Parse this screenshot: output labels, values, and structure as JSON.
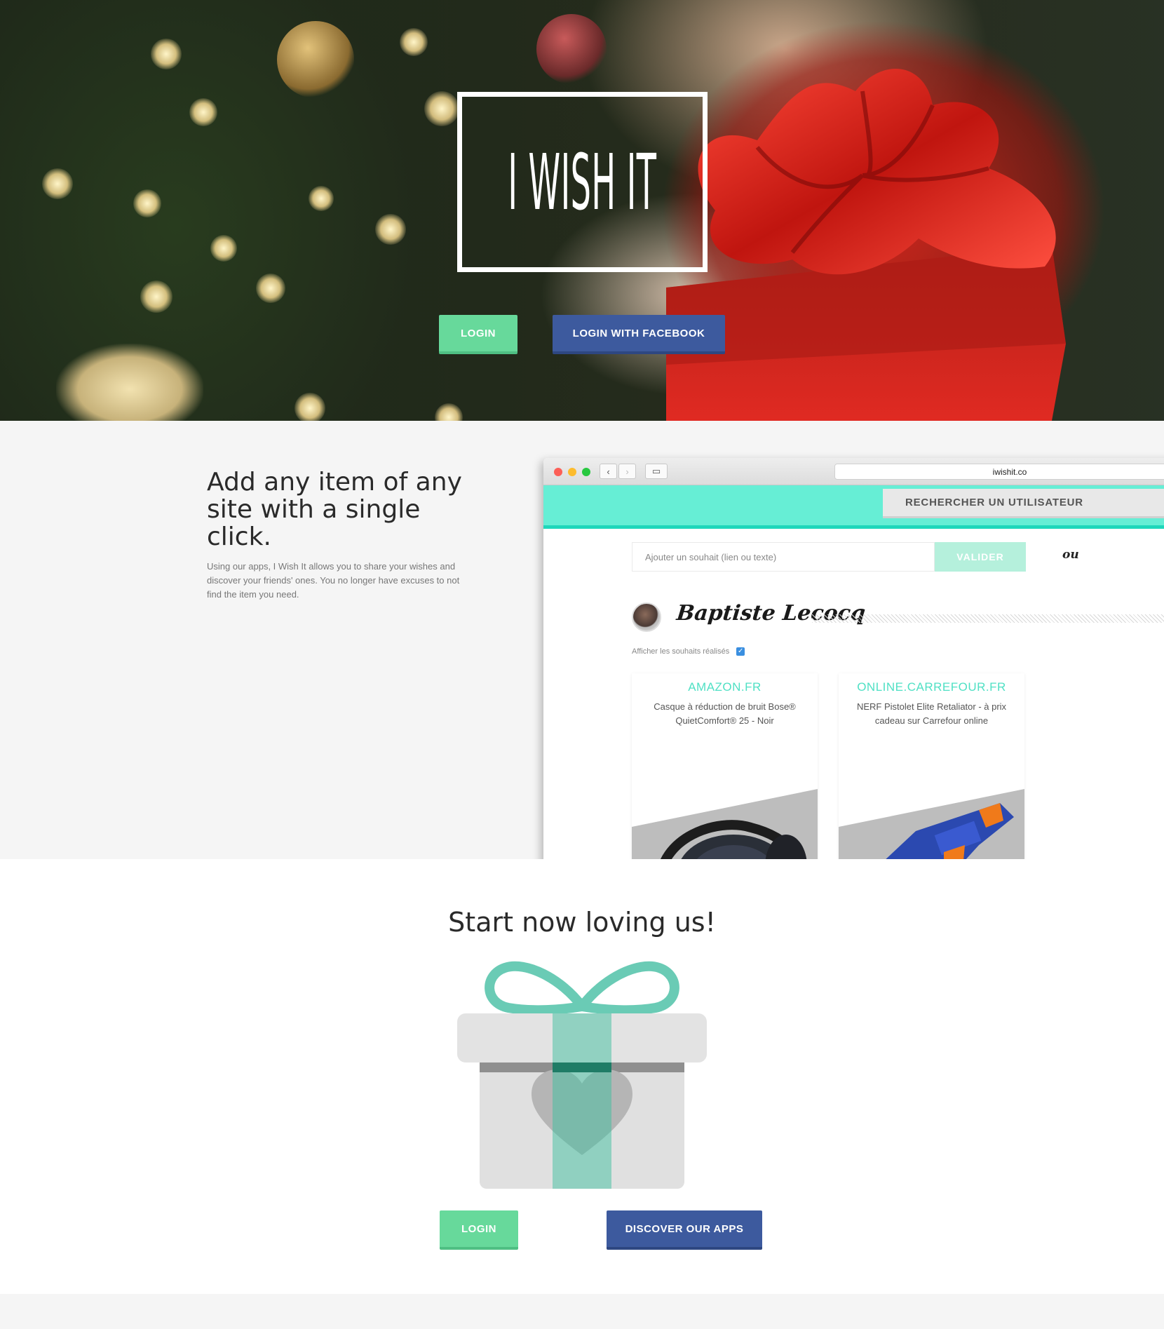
{
  "hero": {
    "logo_text": "I WISH IT",
    "login_label": "LOGIN",
    "facebook_label": "LOGIN WITH FACEBOOK"
  },
  "feature": {
    "title": "Add any item of any site with a single click.",
    "description": "Using our apps, I Wish It allows you to share your wishes and discover your friends' ones. You no longer have excuses to not find the item you need.",
    "browser": {
      "url": "iwishit.co",
      "search_user_label": "RECHERCHER UN UTILISATEUR",
      "wish_placeholder": "Ajouter un souhait (lien ou texte)",
      "valider_label": "VALIDER",
      "or_label": "ou",
      "profile_name": "Baptiste Lecocq",
      "show_done_label": "Afficher les souhaits réalisés",
      "cards": [
        {
          "site": "AMAZON.FR",
          "description": "Casque à réduction de bruit Bose® QuietComfort® 25 - Noir"
        },
        {
          "site": "ONLINE.CARREFOUR.FR",
          "description": "NERF Pistolet Elite Retaliator - à prix cadeau sur Carrefour online"
        }
      ]
    }
  },
  "cta": {
    "title": "Start now loving us!",
    "login_label": "LOGIN",
    "apps_label": "DISCOVER OUR APPS"
  },
  "colors": {
    "green": "#67d99b",
    "blue": "#3d5a9e",
    "turquoise": "#66eed5",
    "gift_ribbon": "#6acbb5"
  },
  "icons": [
    "back-arrow-icon",
    "forward-arrow-icon",
    "sidebar-icon",
    "checkbox-checked-icon",
    "gift-heart-icon"
  ]
}
